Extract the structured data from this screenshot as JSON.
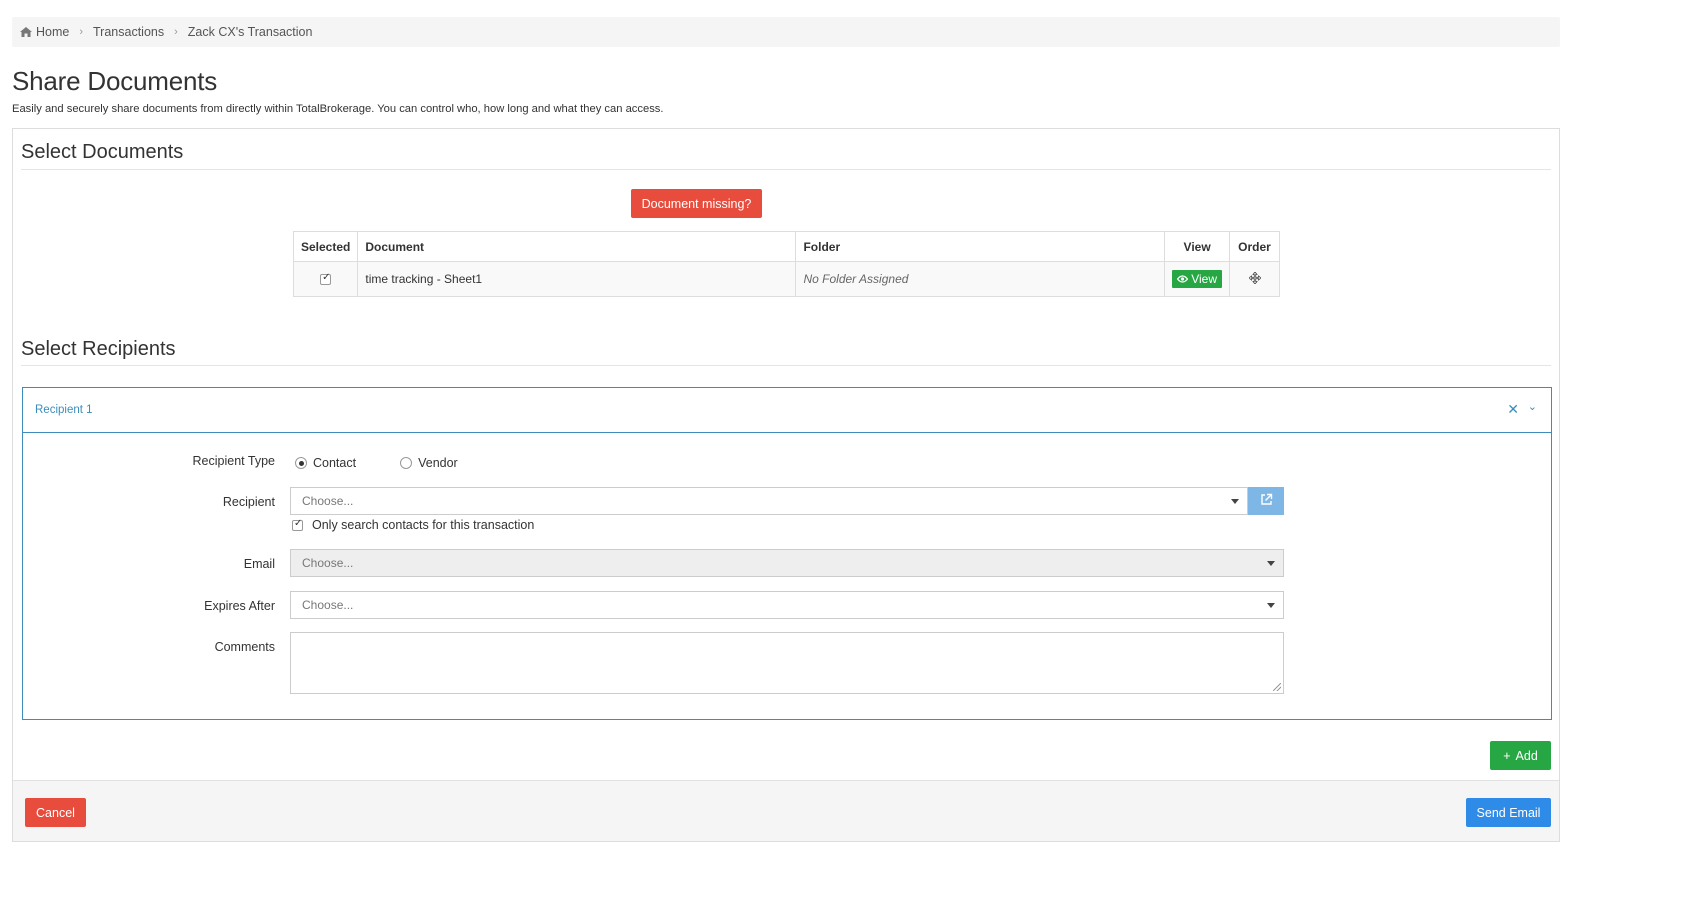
{
  "breadcrumb": {
    "home_icon": "home-icon",
    "home": "Home",
    "transactions": "Transactions",
    "current": "Zack CX's Transaction"
  },
  "page": {
    "title": "Share Documents",
    "subtitle": "Easily and securely share documents from directly within TotalBrokerage. You can control who, how long and what they can access."
  },
  "documents": {
    "section_title": "Select Documents",
    "missing_button": "Document missing?",
    "columns": [
      "Selected",
      "Document",
      "Folder",
      "View",
      "Order"
    ],
    "rows": [
      {
        "selected": true,
        "document": "time tracking - Sheet1",
        "folder": "No Folder Assigned",
        "view_label": "View",
        "view_icon": "eye-icon",
        "order_icon": "move-icon"
      }
    ]
  },
  "recipients": {
    "section_title": "Select Recipients",
    "card": {
      "title": "Recipient 1",
      "close_icon": "close-icon",
      "collapse_icon": "chevron-down-icon",
      "type_label": "Recipient Type",
      "type_options": [
        "Contact",
        "Vendor"
      ],
      "type_selected": "Contact",
      "recipient_label": "Recipient",
      "recipient_placeholder": "Choose...",
      "external_icon": "external-link-icon",
      "only_search_label": "Only search contacts for this transaction",
      "only_search_checked": true,
      "email_label": "Email",
      "email_placeholder": "Choose...",
      "expires_label": "Expires After",
      "expires_placeholder": "Choose...",
      "comments_label": "Comments",
      "comments_value": ""
    },
    "add_button": "Add"
  },
  "footer": {
    "cancel": "Cancel",
    "send": "Send Email"
  },
  "colors": {
    "danger": "#e74c3c",
    "success": "#27a744",
    "primary": "#2f8be8",
    "info_border": "#3c8dbc"
  }
}
